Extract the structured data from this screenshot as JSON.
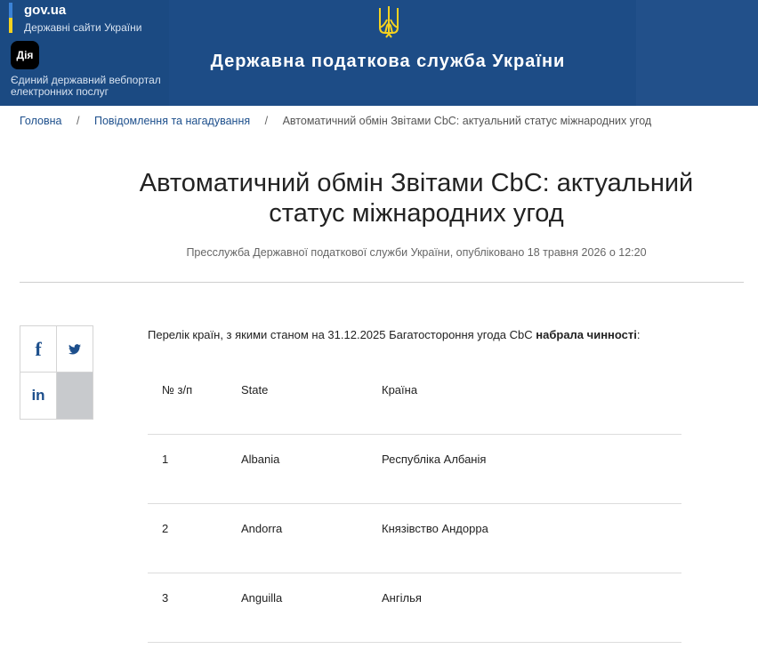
{
  "header": {
    "gov_logo": "gov.ua",
    "gov_subtitle": "Державні сайти України",
    "diia_icon_label": "Дія",
    "diia_text": "Єдиний державний вебпортал електронних послуг",
    "site_title": "Державна податкова служба України",
    "colors": {
      "header_bg": "#1d4c86",
      "flag_blue": "#3b82d6",
      "flag_yellow": "#f5d21f"
    }
  },
  "breadcrumb": {
    "home": "Головна",
    "section": "Повідомлення та нагадування",
    "current": "Автоматичний обмін Звітами CbC: актуальний статус міжнародних угод",
    "separator": "/"
  },
  "article": {
    "title": "Автоматичний обмін Звітами CbC: актуальний статус міжнародних угод",
    "meta": "Пресслужба Державної податкової служби України, опубліковано 18 травня 2026 о 12:20",
    "intro_text": "Перелік країн, з якими станом на 31.12.2025 Багатостороння угода CbC ",
    "intro_bold": "набрала чинності",
    "intro_end": ":"
  },
  "share": {
    "facebook": "f",
    "linkedin": "in",
    "icons": [
      "facebook-icon",
      "twitter-icon",
      "linkedin-icon"
    ]
  },
  "table": {
    "headers": {
      "num": "№ з/п",
      "state": "State",
      "country": "Країна"
    },
    "rows": [
      {
        "num": "1",
        "state": "Albania",
        "country": "Республіка Албанія"
      },
      {
        "num": "2",
        "state": "Andorra",
        "country": "Князівство Андорра"
      },
      {
        "num": "3",
        "state": "Anguilla",
        "country": "Ангілья"
      }
    ]
  }
}
